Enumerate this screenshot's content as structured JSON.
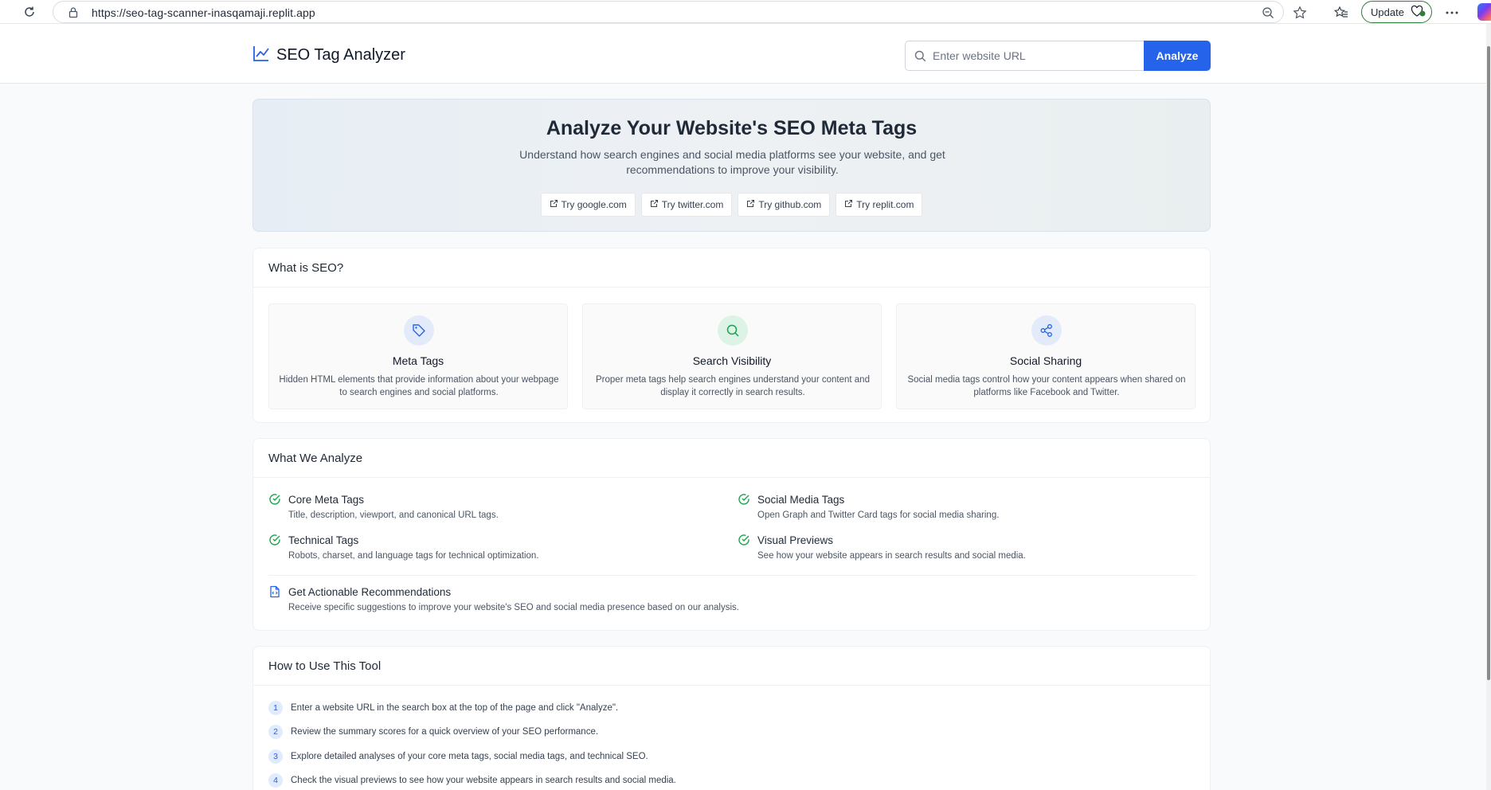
{
  "browser": {
    "url": "https://seo-tag-scanner-inasqamaji.replit.app",
    "update_label": "Update"
  },
  "header": {
    "title": "SEO Tag Analyzer",
    "search_placeholder": "Enter website URL",
    "analyze_label": "Analyze"
  },
  "hero": {
    "title": "Analyze Your Website's SEO Meta Tags",
    "subtitle": "Understand how search engines and social media platforms see your website, and get recommendations to improve your visibility.",
    "try_buttons": [
      "Try google.com",
      "Try twitter.com",
      "Try github.com",
      "Try replit.com"
    ]
  },
  "what_is_seo": {
    "heading": "What is SEO?",
    "features": [
      {
        "title": "Meta Tags",
        "description": "Hidden HTML elements that provide information about your webpage to search engines and social platforms.",
        "icon": "tag-icon",
        "color": "#2563eb"
      },
      {
        "title": "Search Visibility",
        "description": "Proper meta tags help search engines understand your content and display it correctly in search results.",
        "icon": "search-icon",
        "color": "#16a34a"
      },
      {
        "title": "Social Sharing",
        "description": "Social media tags control how your content appears when shared on platforms like Facebook and Twitter.",
        "icon": "share-icon",
        "color": "#2563eb"
      }
    ]
  },
  "what_we_analyze": {
    "heading": "What We Analyze",
    "items": [
      {
        "title": "Core Meta Tags",
        "description": "Title, description, viewport, and canonical URL tags."
      },
      {
        "title": "Social Media Tags",
        "description": "Open Graph and Twitter Card tags for social media sharing."
      },
      {
        "title": "Technical Tags",
        "description": "Robots, charset, and language tags for technical optimization."
      },
      {
        "title": "Visual Previews",
        "description": "See how your website appears in search results and social media."
      }
    ],
    "recommendations": {
      "title": "Get Actionable Recommendations",
      "description": "Receive specific suggestions to improve your website's SEO and social media presence based on our analysis."
    }
  },
  "how_to_use": {
    "heading": "How to Use This Tool",
    "steps": [
      {
        "number": "1",
        "text": "Enter a website URL in the search box at the top of the page and click \"Analyze\"."
      },
      {
        "number": "2",
        "text": "Review the summary scores for a quick overview of your SEO performance."
      },
      {
        "number": "3",
        "text": "Explore detailed analyses of your core meta tags, social media tags, and technical SEO."
      },
      {
        "number": "4",
        "text": "Check the visual previews to see how your website appears in search results and social media."
      }
    ]
  },
  "colors": {
    "accent": "#2563eb",
    "check": "#16a34a"
  }
}
